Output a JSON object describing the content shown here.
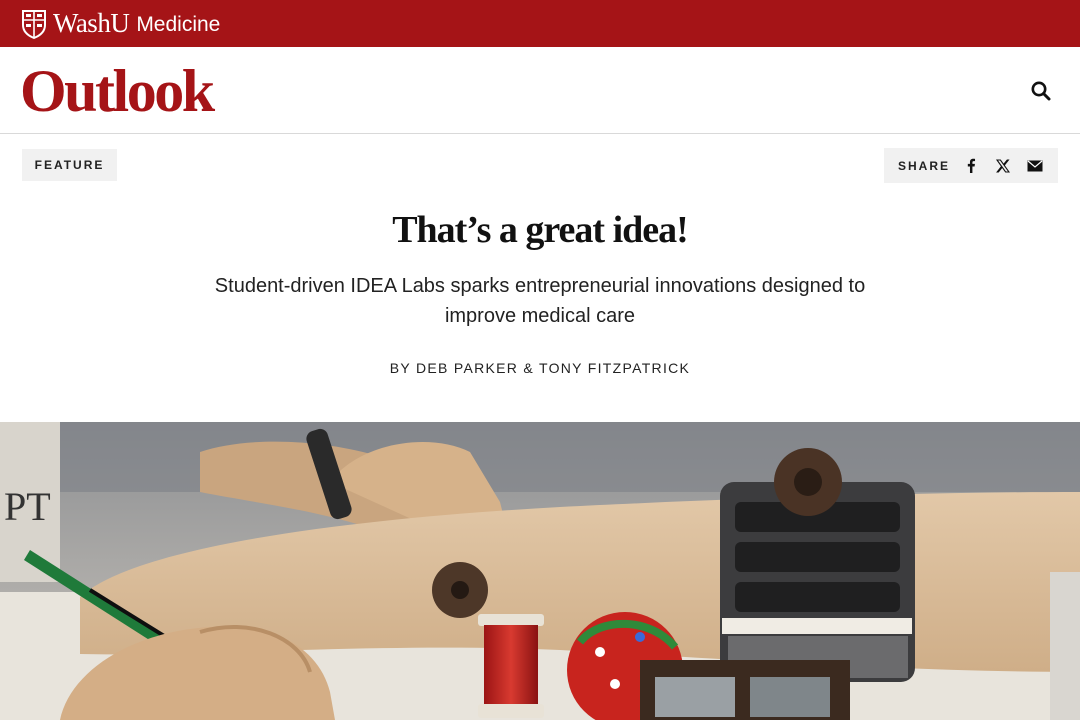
{
  "site": {
    "brand_main": "WashU",
    "brand_sub": "Medicine",
    "publication": "Outlook"
  },
  "article": {
    "category": "FEATURE",
    "share_label": "SHARE",
    "title": "That’s a great idea!",
    "dek": "Student-driven IDEA Labs sparks entrepreneurial innovations designed to improve medical care",
    "byline": "BY DEB PARKER & TONY FITZPATRICK"
  },
  "share_icons": [
    "facebook-icon",
    "x-icon",
    "email-icon"
  ],
  "hero_image": {
    "sign_text": "PT"
  },
  "colors": {
    "brand_red": "#a51417",
    "tag_bg": "#f1f1f1"
  }
}
